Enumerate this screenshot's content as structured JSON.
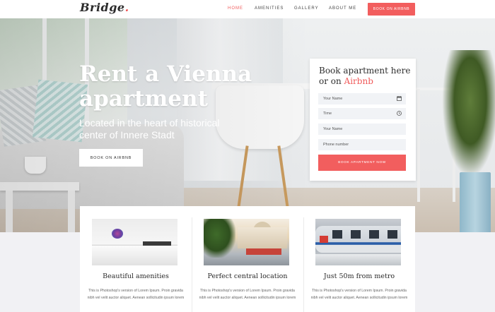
{
  "nav": {
    "logo": "Bridge",
    "logo_dot": ".",
    "links": [
      "HOME",
      "AMENITIES",
      "GALLERY",
      "ABOUT ME"
    ],
    "active_index": 0,
    "cta": "BOOK ON AIRBNB"
  },
  "hero": {
    "title_line1": "Rent a Vienna",
    "title_line2": "apartment",
    "subtitle": "Located in the heart of historical center of Innere Stadt",
    "button": "BOOK ON AIRBNB"
  },
  "booking": {
    "title_part1": "Book apartment here or on ",
    "title_highlight": "Airbnb",
    "fields": [
      {
        "placeholder": "Your Name",
        "icon": "calendar-icon"
      },
      {
        "placeholder": "Time",
        "icon": "clock-icon"
      },
      {
        "placeholder": "Your Name",
        "icon": ""
      },
      {
        "placeholder": "Phone number",
        "icon": ""
      }
    ],
    "submit": "BOOK APARTMENT NOW"
  },
  "features": [
    {
      "title": "Beautiful amenities",
      "text": "This is Photoshop's version of Lorem Ipsum. Proin gravida nibh vel velit auctor aliquet. Aenean sollicitudin ipsum lorem",
      "image": "kitchen"
    },
    {
      "title": "Perfect central location",
      "text": "This is Photoshop's version of Lorem Ipsum. Proin gravida nibh vel velit auctor aliquet. Aenean sollicitudin ipsum lorem",
      "image": "city"
    },
    {
      "title": "Just 50m from metro",
      "text": "This is Photoshop's version of Lorem Ipsum. Proin gravida nibh vel velit auctor aliquet. Aenean sollicitudin ipsum lorem",
      "image": "metro"
    }
  ],
  "colors": {
    "accent": "#f25e5e",
    "text_dark": "#2b2b2b",
    "field_bg": "#f1f3f6"
  }
}
